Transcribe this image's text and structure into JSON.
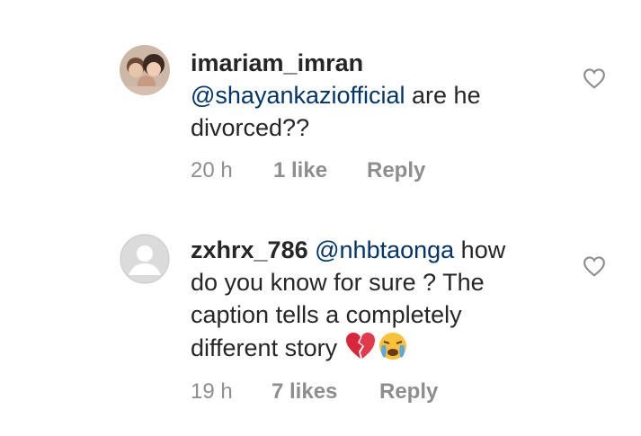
{
  "comments": [
    {
      "username": "imariam_imran",
      "mention": "@shayankazi​official",
      "text_line1_rest": " are he",
      "text_line2": "divorced??",
      "time": "20 h",
      "likes": "1 like",
      "reply": "Reply",
      "avatar_icon": "profile-photo",
      "like_icon": "heart-outline-icon"
    },
    {
      "username": "zxhrx_786",
      "mention": "@nhbtaonga",
      "text_line1_rest": " how",
      "text_line2": "do you know for sure ? The",
      "text_line3": "caption tells a completely",
      "text_line4": "different story ",
      "emojis": [
        "broken-heart-emoji",
        "crying-face-emoji"
      ],
      "time": "19 h",
      "likes": "7 likes",
      "reply": "Reply",
      "avatar_icon": "default-profile-icon",
      "like_icon": "heart-outline-icon"
    }
  ],
  "colors": {
    "mention": "#003569",
    "meta": "#8e8e8e",
    "text": "#262626"
  }
}
